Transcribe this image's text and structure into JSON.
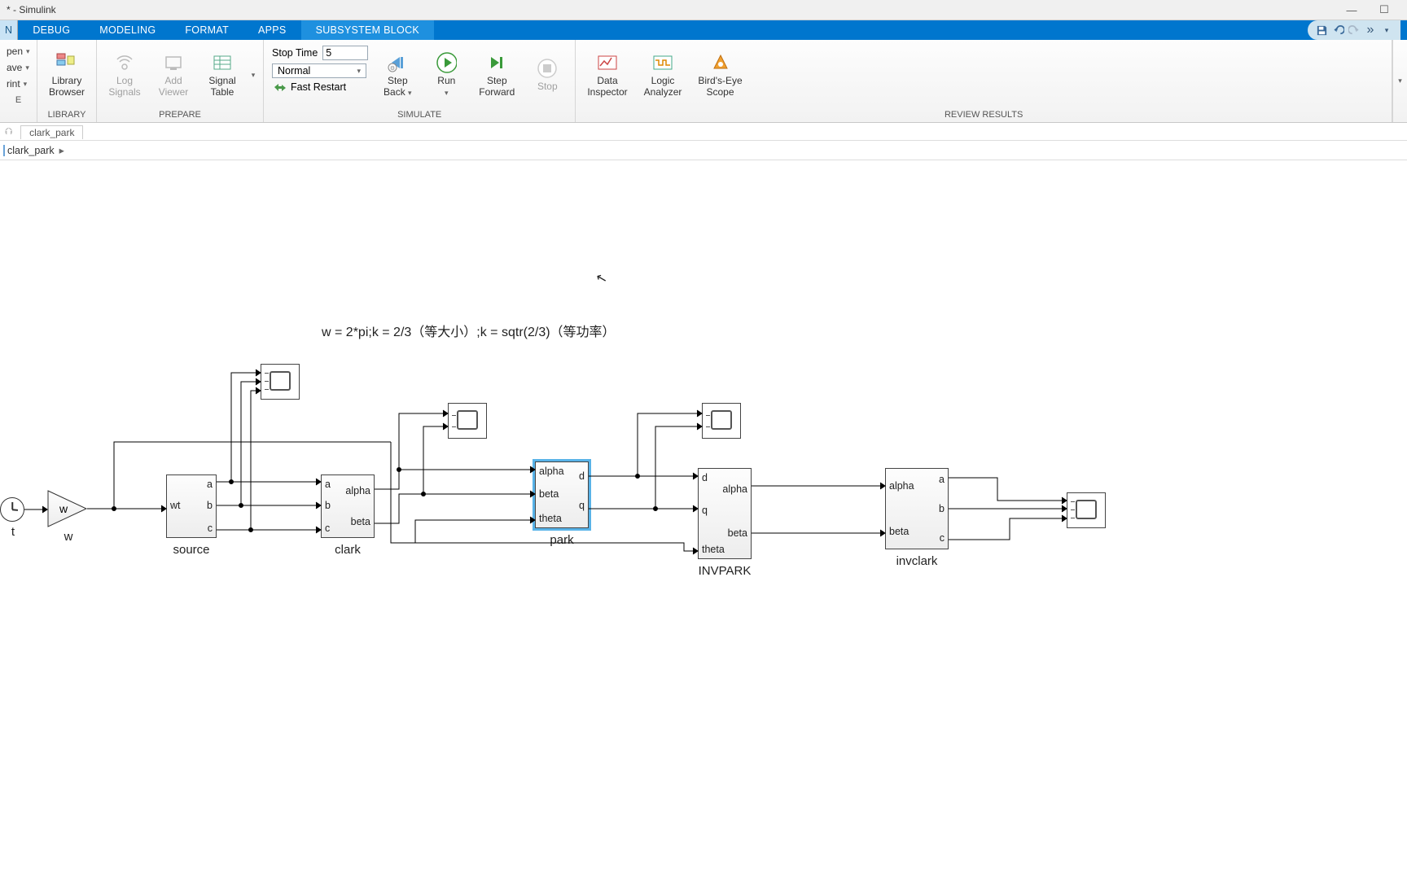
{
  "window": {
    "title": "* - Simulink"
  },
  "tabs": {
    "cut": "N",
    "items": [
      "DEBUG",
      "MODELING",
      "FORMAT",
      "APPS",
      "SUBSYSTEM BLOCK"
    ],
    "activeIndex": 4
  },
  "quick": {
    "left": [
      "pen",
      "ave",
      "rint",
      "E"
    ]
  },
  "ribbon": {
    "library": {
      "btn": "Library\nBrowser",
      "label": "LIBRARY"
    },
    "prepare": {
      "log": "Log\nSignals",
      "add": "Add\nViewer",
      "signal": "Signal\nTable",
      "label": "PREPARE"
    },
    "simulate": {
      "stopTimeLabel": "Stop Time",
      "stopTimeValue": "5",
      "mode": "Normal",
      "fast": "Fast Restart",
      "stepBack": "Step\nBack",
      "run": "Run",
      "stepFwd": "Step\nForward",
      "stop": "Stop",
      "label": "SIMULATE"
    },
    "review": {
      "data": "Data\nInspector",
      "logic": "Logic\nAnalyzer",
      "birds": "Bird's-Eye\nScope",
      "label": "REVIEW RESULTS"
    }
  },
  "nav": {
    "tab": "clark_park",
    "crumb": "clark_park"
  },
  "annotation": "w = 2*pi;k = 2/3（等大小）;k = sqtr(2/3)（等功率）",
  "blocks": {
    "clockLabel": "t",
    "gain": "w",
    "gainName": "w",
    "source": {
      "name": "source",
      "in": [
        "wt"
      ],
      "out": [
        "a",
        "b",
        "c"
      ]
    },
    "clark": {
      "name": "clark",
      "in": [
        "a",
        "b",
        "c"
      ],
      "out": [
        "alpha",
        "beta"
      ]
    },
    "park": {
      "name": "park",
      "in": [
        "alpha",
        "beta",
        "theta"
      ],
      "out": [
        "d",
        "q"
      ]
    },
    "invpark": {
      "name": "INVPARK",
      "in": [
        "d",
        "q",
        "theta"
      ],
      "out": [
        "alpha",
        "beta"
      ]
    },
    "invclark": {
      "name": "invclark",
      "in": [
        "alpha",
        "beta"
      ],
      "out": [
        "a",
        "b",
        "c"
      ]
    }
  }
}
